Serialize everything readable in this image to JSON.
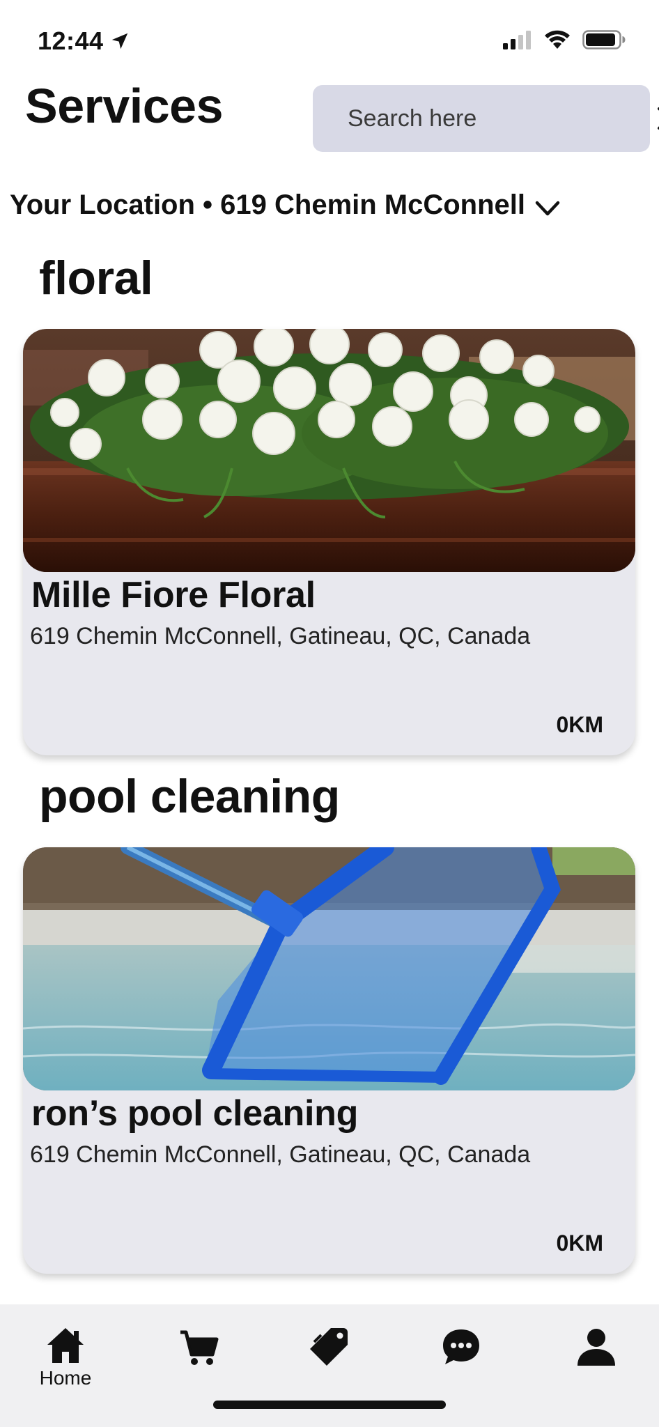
{
  "status_bar": {
    "time": "12:44",
    "icons": [
      "location-arrow-icon",
      "cellular-signal-icon",
      "wifi-icon",
      "battery-icon"
    ]
  },
  "header": {
    "title": "Services",
    "search": {
      "placeholder": "Search here",
      "value": ""
    }
  },
  "location": {
    "text": "Your Location • 619 Chemin McConnell"
  },
  "sections": [
    {
      "title": "floral",
      "card": {
        "name": "Mille Fiore Floral",
        "address": "619 Chemin McConnell, Gatineau, QC, Canada",
        "distance": "0KM",
        "image": "white-roses-casket-spray-photo"
      }
    },
    {
      "title": "pool cleaning",
      "card": {
        "name": "ron’s pool cleaning",
        "address": "619 Chemin McConnell, Gatineau, QC, Canada",
        "distance": "0KM",
        "image": "pool-skimmer-net-photo"
      }
    }
  ],
  "tab_bar": {
    "tabs": [
      {
        "icon": "home-icon",
        "label": "Home",
        "active": true
      },
      {
        "icon": "cart-icon",
        "label": ""
      },
      {
        "icon": "tag-icon",
        "label": ""
      },
      {
        "icon": "chat-bubble-icon",
        "label": ""
      },
      {
        "icon": "profile-icon",
        "label": ""
      }
    ]
  },
  "colors": {
    "search_bg": "#d8d9e6",
    "card_bg": "#e8e8ee",
    "tab_bar_bg": "#f0f0f2",
    "text": "#111111"
  }
}
